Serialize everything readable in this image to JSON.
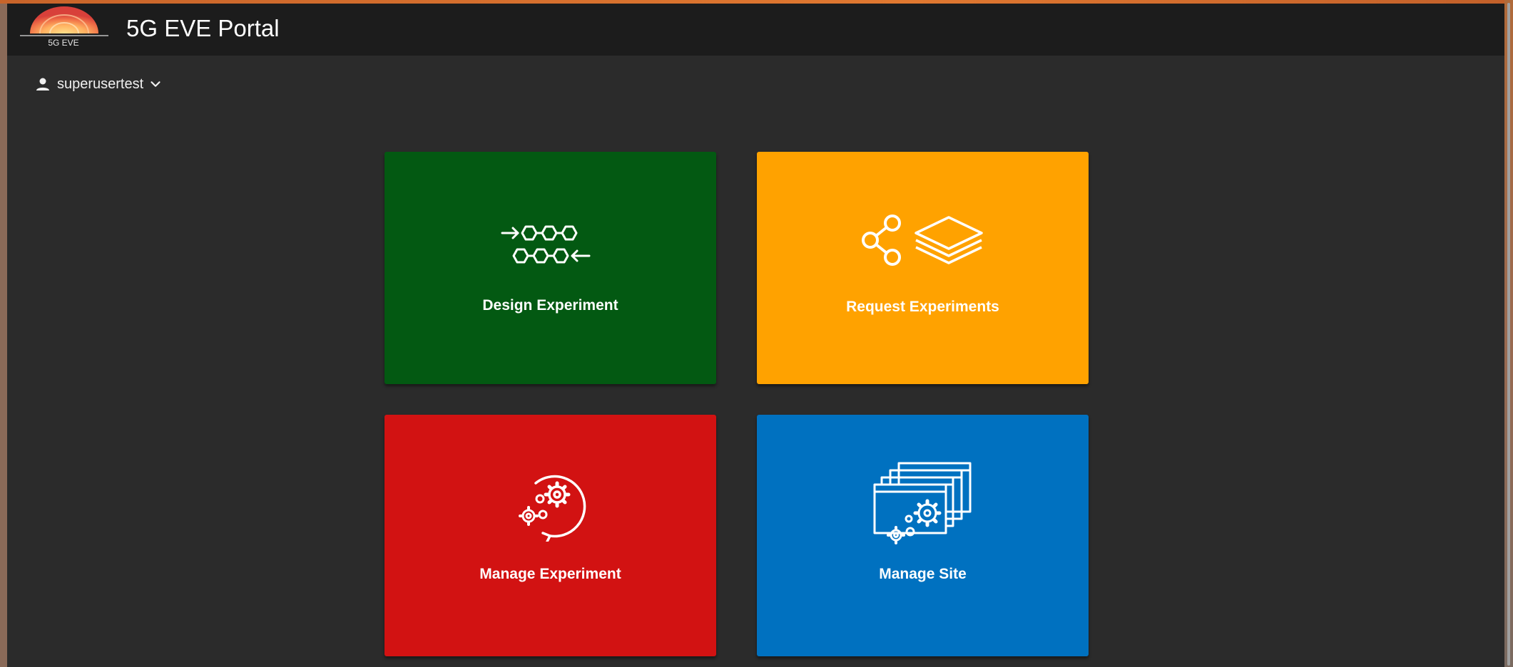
{
  "header": {
    "logo_caption": "5G EVE",
    "title": "5G EVE Portal",
    "logo_icon": "5g-eve-logo"
  },
  "user_menu": {
    "username": "superusertest",
    "icon": "person-icon",
    "dropdown_icon": "chevron-down-icon"
  },
  "tiles": [
    {
      "label": "Design Experiment",
      "color": "#035912",
      "icon": "hexagon-chain-icon"
    },
    {
      "label": "Request Experiments",
      "color": "#ffa200",
      "icon": "share-layers-icon"
    },
    {
      "label": "Manage Experiment",
      "color": "#d21212",
      "icon": "gears-cycle-icon"
    },
    {
      "label": "Manage Site",
      "color": "#0071c0",
      "icon": "windows-gears-icon"
    }
  ],
  "colors": {
    "background": "#2b2b2b",
    "header": "#1c1c1c",
    "accent": "#e07830"
  }
}
